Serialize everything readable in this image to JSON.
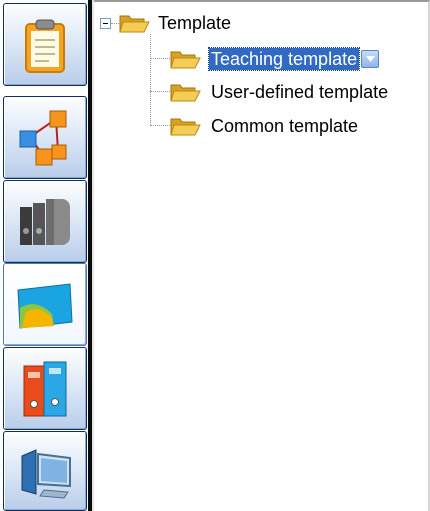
{
  "sidebar": {
    "buttons": [
      {
        "name": "clipboard-icon"
      },
      {
        "name": "network-icon"
      },
      {
        "name": "binders-icon"
      },
      {
        "name": "card-icon"
      },
      {
        "name": "folders-icon"
      },
      {
        "name": "computer-icon"
      }
    ],
    "active_index": 3
  },
  "tree": {
    "root": {
      "label": "Template",
      "expanded": true
    },
    "children": [
      {
        "label": "Teaching template",
        "selected": true
      },
      {
        "label": "User-defined template",
        "selected": false
      },
      {
        "label": "Common template",
        "selected": false
      }
    ]
  },
  "colors": {
    "selection": "#316ac5",
    "folder": "#f2c24b",
    "sidebar_border": "#0b2f60"
  }
}
